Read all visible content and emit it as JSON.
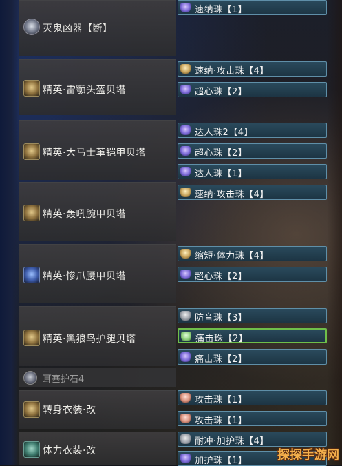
{
  "equipment": [
    {
      "name": "灭鬼凶器【断】",
      "icon": "weapon-icon"
    },
    {
      "name": "精英·雷颚头盔贝塔",
      "icon": "helmet-icon"
    },
    {
      "name": "精英·大马士革铠甲贝塔",
      "icon": "chest-armor-icon"
    },
    {
      "name": "精英·轰吼腕甲贝塔",
      "icon": "gauntlet-icon"
    },
    {
      "name": "精英·惨爪腰甲贝塔",
      "icon": "waist-armor-icon"
    },
    {
      "name": "精英·黑狼鸟护腿贝塔",
      "icon": "leg-armor-icon"
    },
    {
      "name": "转身衣装·改",
      "icon": "mantle-icon"
    },
    {
      "name": "体力衣装·改",
      "icon": "mantle-icon"
    }
  ],
  "charm": {
    "name": "耳塞护石4",
    "icon": "charm-icon"
  },
  "slots": [
    {
      "label": "速纳珠【1】",
      "jewel": "purple"
    },
    {
      "label": "速纳·攻击珠【4】",
      "jewel": "gold"
    },
    {
      "label": "超心珠【2】",
      "jewel": "purple"
    },
    {
      "label": "达人珠2【4】",
      "jewel": "purple"
    },
    {
      "label": "超心珠【2】",
      "jewel": "purple"
    },
    {
      "label": "达人珠【1】",
      "jewel": "purple"
    },
    {
      "label": "速纳·攻击珠【4】",
      "jewel": "gold"
    },
    {
      "label": "缩短·体力珠【4】",
      "jewel": "gold"
    },
    {
      "label": "超心珠【2】",
      "jewel": "purple"
    },
    {
      "label": "防音珠【3】",
      "jewel": "gray"
    },
    {
      "label": "痛击珠【2】",
      "jewel": "green"
    },
    {
      "label": "痛击珠【2】",
      "jewel": "purple"
    },
    {
      "label": "攻击珠【1】",
      "jewel": "red"
    },
    {
      "label": "攻击珠【1】",
      "jewel": "red"
    },
    {
      "label": "耐冲·加护珠【4】",
      "jewel": "gray"
    },
    {
      "label": "加护珠【1】",
      "jewel": "purple"
    }
  ],
  "watermark": "探探手游网"
}
